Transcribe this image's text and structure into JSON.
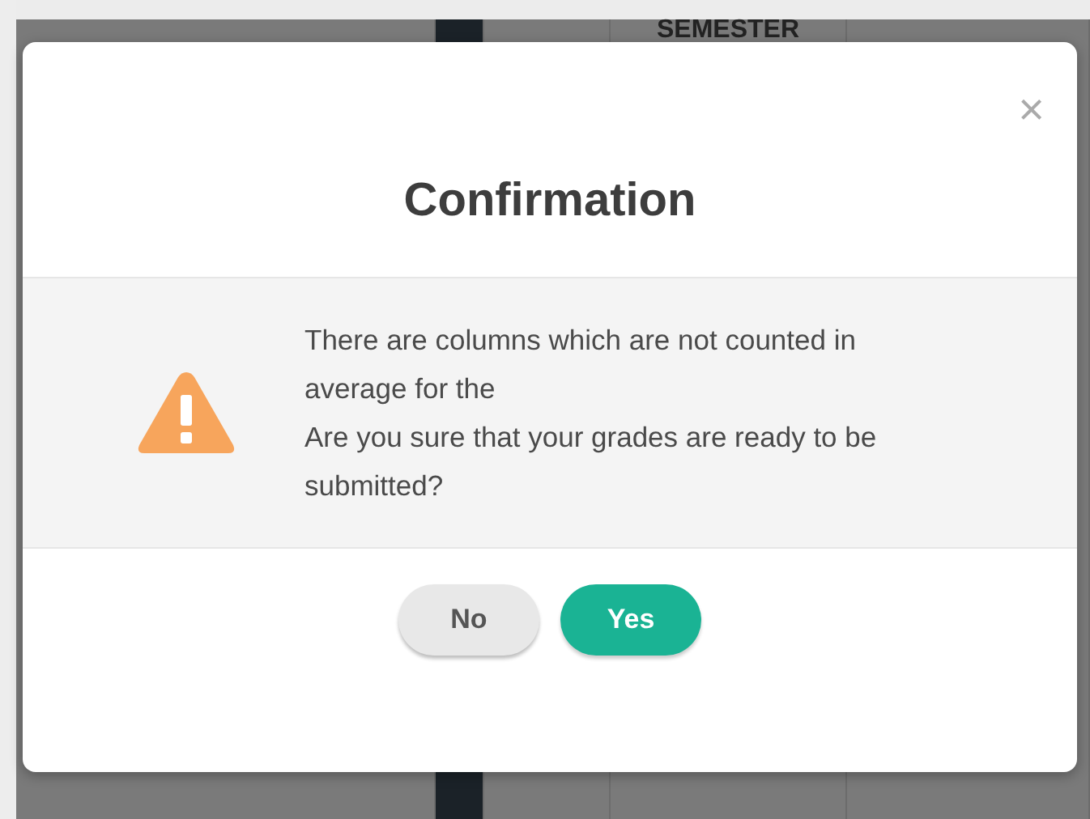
{
  "background_table": {
    "header": "SEMESTER"
  },
  "dialog": {
    "close": "×",
    "title": "Confirmation",
    "message": [
      "There are columns which are not counted in average for the",
      "Are you sure that your grades are ready to be submitted?"
    ],
    "buttons": [
      {
        "label": "No",
        "kind": "secondary"
      },
      {
        "label": "Yes",
        "kind": "primary"
      }
    ]
  }
}
